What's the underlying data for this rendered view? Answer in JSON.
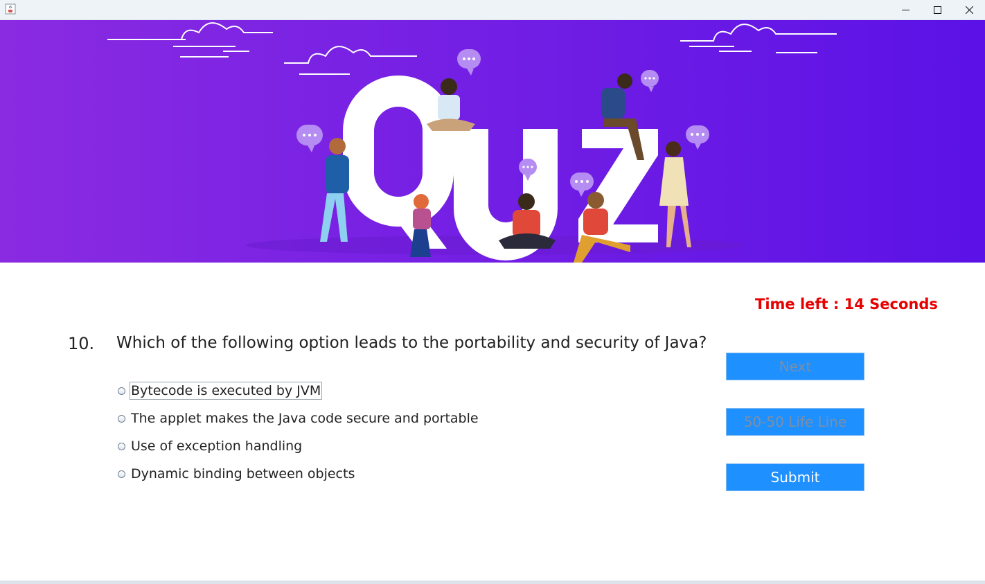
{
  "window": {
    "app_icon": "java-cup-icon",
    "controls": [
      "minimize-icon",
      "maximize-icon",
      "close-icon"
    ]
  },
  "banner": {
    "headline": "QUIZ",
    "colors": {
      "gradient_start": "#8a2be2",
      "gradient_end": "#5b12e6",
      "letters": "#ffffff"
    }
  },
  "timer": {
    "text": "Time left : 14 Seconds",
    "color": "#e60000"
  },
  "question": {
    "number": "10.",
    "text": "Which of the following option leads to the portability and security of Java?"
  },
  "options": [
    {
      "label": "Bytecode is executed by JVM",
      "selected": false,
      "focused": true
    },
    {
      "label": "The applet makes the Java code secure and portable",
      "selected": false,
      "focused": false
    },
    {
      "label": "Use of exception handling",
      "selected": false,
      "focused": false
    },
    {
      "label": "Dynamic binding between objects",
      "selected": false,
      "focused": false
    }
  ],
  "buttons": {
    "next": {
      "label": "Next",
      "enabled": false
    },
    "lifeline": {
      "label": "50-50 Life Line",
      "enabled": false
    },
    "submit": {
      "label": "Submit",
      "enabled": true
    },
    "color": "#1e90ff"
  }
}
